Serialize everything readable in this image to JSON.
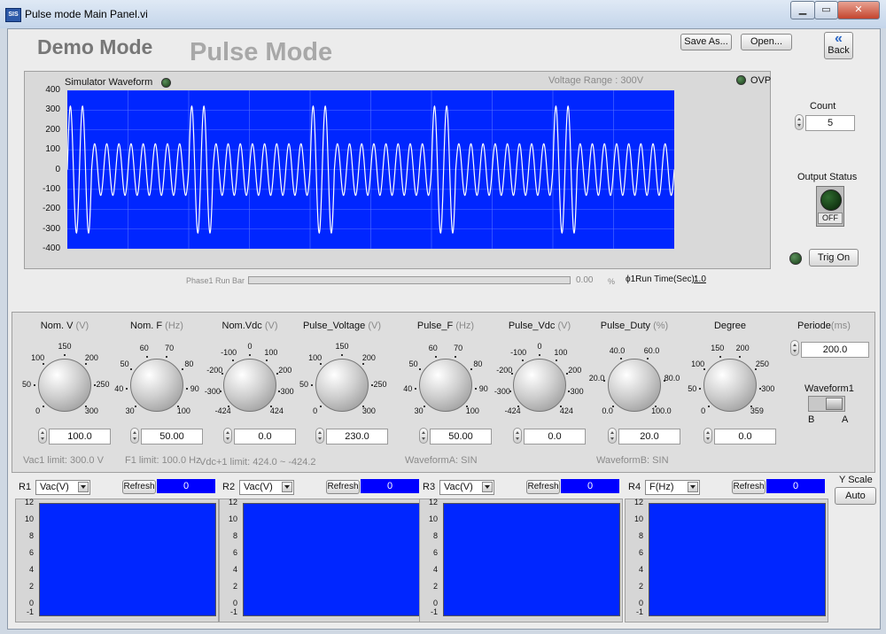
{
  "window": {
    "title": "Pulse mode Main Panel.vi",
    "minimize": "▁",
    "maximize": "▭",
    "close": "✕"
  },
  "header": {
    "demo_mode": "Demo Mode",
    "pulse_mode": "Pulse Mode",
    "save_as": "Save As...",
    "open": "Open...",
    "back_arrow": "«",
    "back": "Back"
  },
  "graph": {
    "label": "Simulator Waveform",
    "voltage_range": "Voltage Range : 300V",
    "ovp": "OVP",
    "y_ticks": [
      "400",
      "300",
      "200",
      "100",
      "0",
      "-100",
      "-200",
      "-300",
      "-400"
    ],
    "plot_color": "#0026ff",
    "trace_color": "#ffffff"
  },
  "chart_data": {
    "type": "line",
    "ylim": [
      -400,
      400
    ],
    "grid": true,
    "base_amplitude": 130,
    "pulse_amplitude": 320,
    "cycles_per_period": 10,
    "periods": 5,
    "pulse_cycles": 2
  },
  "runbar": {
    "label": "Phase1 Run Bar",
    "value": "0.00",
    "unit": "%",
    "runtime_label": "ϕ1Run Time(Sec):",
    "runtime_value": "1.0"
  },
  "count": {
    "label": "Count",
    "value": "5"
  },
  "output": {
    "label": "Output Status",
    "state": "OFF"
  },
  "trig": {
    "label": "Trig On"
  },
  "knobs": [
    {
      "name": "Nom. V",
      "unit": "(V)",
      "value": "100.0",
      "ticks": [
        "0",
        "50",
        "100",
        "150",
        "200",
        "250",
        "300"
      ]
    },
    {
      "name": "Nom. F",
      "unit": "(Hz)",
      "value": "50.00",
      "ticks": [
        "30",
        "40",
        "50",
        "60",
        "70",
        "80",
        "90",
        "100"
      ]
    },
    {
      "name": "Nom.Vdc",
      "unit": "(V)",
      "value": "0.0",
      "ticks": [
        "-424",
        "-300",
        "-200",
        "-100",
        "0",
        "100",
        "200",
        "300",
        "424"
      ]
    },
    {
      "name": "Pulse_Voltage",
      "unit": "(V)",
      "value": "230.0",
      "ticks": [
        "0",
        "50",
        "100",
        "150",
        "200",
        "250",
        "300"
      ]
    },
    {
      "name": "Pulse_F",
      "unit": "(Hz)",
      "value": "50.00",
      "ticks": [
        "30",
        "40",
        "50",
        "60",
        "70",
        "80",
        "90",
        "100"
      ]
    },
    {
      "name": "Pulse_Vdc",
      "unit": "(V)",
      "value": "0.0",
      "ticks": [
        "-424",
        "-300",
        "-200",
        "-100",
        "0",
        "100",
        "200",
        "300",
        "424"
      ]
    },
    {
      "name": "Pulse_Duty",
      "unit": "(%)",
      "value": "20.0",
      "ticks": [
        "0.0",
        "20.0",
        "40.0",
        "60.0",
        "80.0",
        "100.0"
      ]
    },
    {
      "name": "Degree",
      "unit": "",
      "value": "0.0",
      "ticks": [
        "0",
        "50",
        "100",
        "150",
        "200",
        "250",
        "300",
        "359"
      ]
    }
  ],
  "periode": {
    "label": "Periode",
    "unit": "(ms)",
    "value": "200.0"
  },
  "waveform1": {
    "label": "Waveform1",
    "b": "B",
    "a": "A"
  },
  "limits": {
    "vac1_label": "Vac1 limit:",
    "vac1_value": "300.0",
    "vac1_unit": "V",
    "f1_label": "F1 limit:",
    "f1_value": "100.0",
    "f1_unit": "Hz",
    "vdc1_label": "Vdc+1 limit:",
    "vdc1_value": "424.0",
    "vdc1_sep": "~",
    "vdc1_min": "-424.2",
    "wfa_label": "WaveformA:",
    "wfa_value": "SIN",
    "wfb_label": "WaveformB:",
    "wfb_value": "SIN"
  },
  "readouts": [
    {
      "id": "R1",
      "select": "Vac(V)",
      "refresh": "Refresh",
      "value": "0"
    },
    {
      "id": "R2",
      "select": "Vac(V)",
      "refresh": "Refresh",
      "value": "0"
    },
    {
      "id": "R3",
      "select": "Vac(V)",
      "refresh": "Refresh",
      "value": "0"
    },
    {
      "id": "R4",
      "select": "F(Hz)",
      "refresh": "Refresh",
      "value": "0"
    }
  ],
  "mini_y_ticks": [
    "12",
    "10",
    "8",
    "6",
    "4",
    "2",
    "0",
    "-1"
  ],
  "yscale": {
    "label": "Y Scale",
    "auto": "Auto"
  }
}
